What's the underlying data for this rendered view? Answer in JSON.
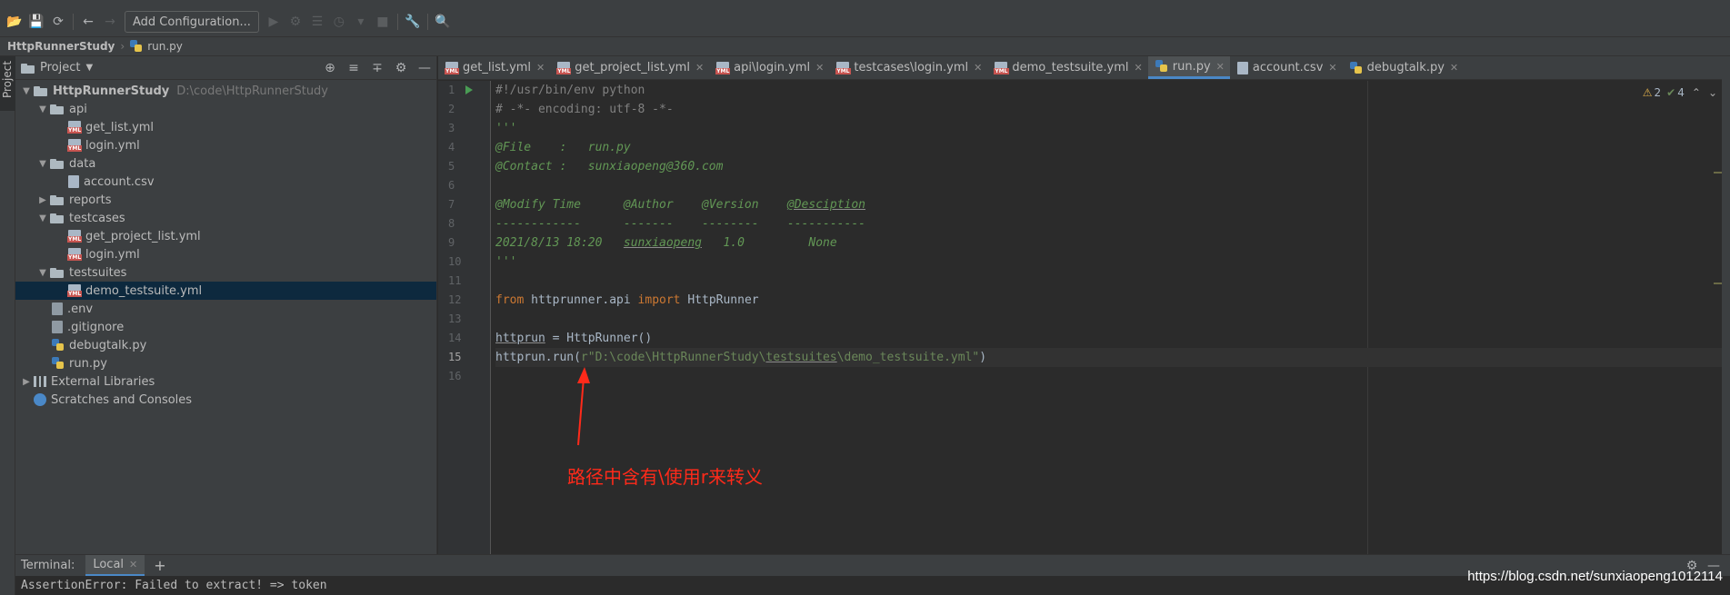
{
  "toolbar": {
    "add_configuration_label": "Add Configuration..."
  },
  "breadcrumb": {
    "project": "HttpRunnerStudy",
    "file": "run.py"
  },
  "left_strip": {
    "project_tab_label": "Project"
  },
  "project_panel": {
    "title": "Project",
    "tree": [
      {
        "label": "HttpRunnerStudy",
        "path": "D:\\code\\HttpRunnerStudy"
      },
      {
        "label": "api"
      },
      {
        "label": "get_list.yml"
      },
      {
        "label": "login.yml"
      },
      {
        "label": "data"
      },
      {
        "label": "account.csv"
      },
      {
        "label": "reports"
      },
      {
        "label": "testcases"
      },
      {
        "label": "get_project_list.yml"
      },
      {
        "label": "login.yml"
      },
      {
        "label": "testsuites"
      },
      {
        "label": "demo_testsuite.yml"
      },
      {
        "label": ".env"
      },
      {
        "label": ".gitignore"
      },
      {
        "label": "debugtalk.py"
      },
      {
        "label": "run.py"
      },
      {
        "label": "External Libraries"
      },
      {
        "label": "Scratches and Consoles"
      }
    ]
  },
  "editor": {
    "tabs": [
      {
        "label": "get_list.yml"
      },
      {
        "label": "get_project_list.yml"
      },
      {
        "label": "api\\login.yml"
      },
      {
        "label": "testcases\\login.yml"
      },
      {
        "label": "demo_testsuite.yml"
      },
      {
        "label": "run.py"
      },
      {
        "label": "account.csv"
      },
      {
        "label": "debugtalk.py"
      }
    ],
    "line_numbers": [
      "1",
      "2",
      "3",
      "4",
      "5",
      "6",
      "7",
      "8",
      "9",
      "10",
      "11",
      "12",
      "13",
      "14",
      "15",
      "16"
    ],
    "inspection": {
      "warnings": "2",
      "weak_warnings": "4"
    },
    "code": {
      "l1": "#!/usr/bin/env python",
      "l2": "# -*- encoding: utf-8 -*-",
      "l3": "'''",
      "l4": "@File    :   run.py",
      "l5": "@Contact :   sunxiaopeng@360.com",
      "l6": "",
      "l7a": "@Modify Time      @Author    @Version    ",
      "l7b": "@Desciption",
      "l8": "------------      -------    --------    -----------",
      "l9a": "2021/8/13 18:20   ",
      "l9b": "sunxiaopeng",
      "l9c": "   1.0         None",
      "l10": "'''",
      "l11": "",
      "l12_kw1": "from",
      "l12_mod": " httprunner.api ",
      "l12_kw2": "import",
      "l12_name": " HttpRunner",
      "l13": "",
      "l14_var": "httprun",
      "l14_rest": " = HttpRunner()",
      "l15_pre": "httprun.run(",
      "l15_str1": "r\"D:\\code\\HttpRunnerStudy\\",
      "l15_str2": "testsuites",
      "l15_str3": "\\demo_testsuite.yml\"",
      "l15_post": ")",
      "l16": ""
    }
  },
  "annotation": {
    "text": "路径中含有\\使用r来转义"
  },
  "terminal": {
    "title": "Terminal:",
    "tab_label": "Local",
    "output": "AssertionError: Failed to extract! => token"
  },
  "watermark": "https://blog.csdn.net/sunxiaopeng1012114"
}
